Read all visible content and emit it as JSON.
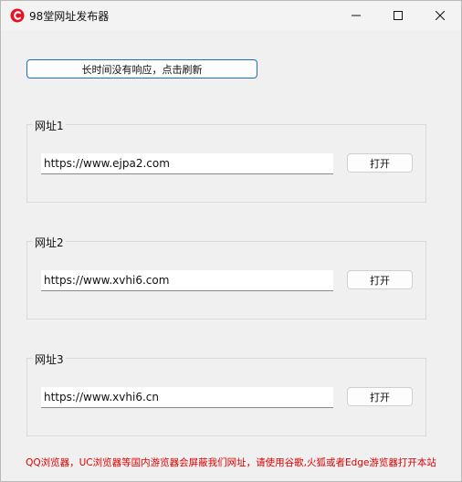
{
  "window": {
    "title": "98堂网址发布器",
    "accent_color": "#e81123",
    "icons": {
      "app": "app-logo-icon",
      "minimize": "minimize-icon",
      "maximize": "maximize-icon",
      "close": "close-icon"
    }
  },
  "refresh_button": {
    "label": "长时间没有响应，点击刷新"
  },
  "groups": [
    {
      "label": "网址1",
      "url": "https://www.ejpa2.com",
      "open_label": "打开"
    },
    {
      "label": "网址2",
      "url": "https://www.xvhi6.com",
      "open_label": "打开"
    },
    {
      "label": "网址3",
      "url": "https://www.xvhi6.cn",
      "open_label": "打开"
    }
  ],
  "footer": {
    "note": "QQ浏览器，UC浏览器等国内游览器会屏蔽我们网址，请使用谷歌,火狐或者Edge游览器打开本站",
    "color": "#e00000"
  }
}
